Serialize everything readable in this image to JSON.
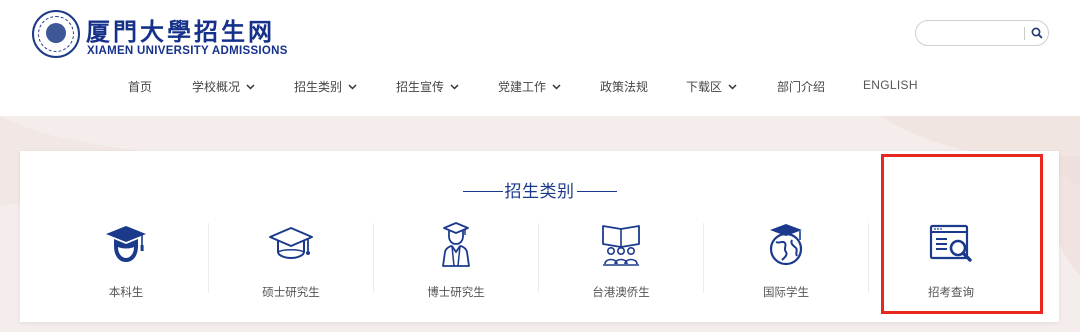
{
  "header": {
    "logo_cn": "厦門大學招生网",
    "logo_en": "XIAMEN UNIVERSITY ADMISSIONS",
    "search": {
      "placeholder": "",
      "icon": "search-icon"
    }
  },
  "nav": {
    "items": [
      {
        "label": "首页",
        "has_dropdown": false
      },
      {
        "label": "学校概况",
        "has_dropdown": true
      },
      {
        "label": "招生类别",
        "has_dropdown": true
      },
      {
        "label": "招生宣传",
        "has_dropdown": true
      },
      {
        "label": "党建工作",
        "has_dropdown": true
      },
      {
        "label": "政策法规",
        "has_dropdown": false
      },
      {
        "label": "下载区",
        "has_dropdown": true
      },
      {
        "label": "部门介绍",
        "has_dropdown": false
      },
      {
        "label": "ENGLISH",
        "has_dropdown": false
      }
    ]
  },
  "panel": {
    "title": "招生类别",
    "categories": [
      {
        "label": "本科生",
        "icon": "graduate-cap-person-icon"
      },
      {
        "label": "硕士研究生",
        "icon": "mortarboard-icon"
      },
      {
        "label": "博士研究生",
        "icon": "doctor-gown-icon"
      },
      {
        "label": "台港澳侨生",
        "icon": "reading-people-icon"
      },
      {
        "label": "国际学生",
        "icon": "globe-cap-icon"
      },
      {
        "label": "招考查询",
        "icon": "window-search-icon"
      }
    ]
  },
  "colors": {
    "brand": "#16318a",
    "icon": "#1b3a8c",
    "highlight": "#e8281e",
    "background": "#f3ecea"
  }
}
